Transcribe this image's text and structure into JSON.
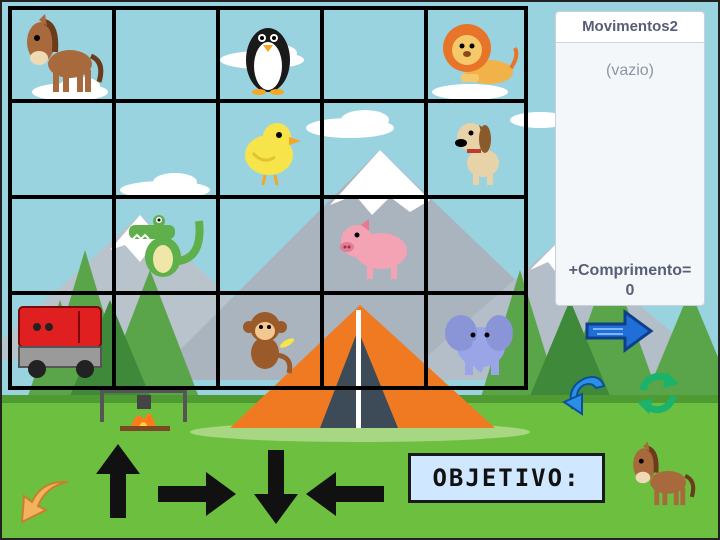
{
  "variable_monitor": {
    "title": "Movimentos2",
    "empty_text": "(vazio)",
    "length_label": "+Comprimento=",
    "length_value": "0"
  },
  "objective": {
    "label": "OBJETIVO:"
  },
  "grid": {
    "rows": 4,
    "cols": 5,
    "animals": [
      {
        "name": "horse",
        "row": 0,
        "col": 0
      },
      {
        "name": "penguin",
        "row": 0,
        "col": 2
      },
      {
        "name": "lion",
        "row": 0,
        "col": 4
      },
      {
        "name": "chick",
        "row": 1,
        "col": 2
      },
      {
        "name": "dog",
        "row": 1,
        "col": 4
      },
      {
        "name": "crocodile",
        "row": 2,
        "col": 1
      },
      {
        "name": "pig",
        "row": 2,
        "col": 3
      },
      {
        "name": "truck",
        "row": 3,
        "col": 0
      },
      {
        "name": "monkey",
        "row": 3,
        "col": 2
      },
      {
        "name": "elephant",
        "row": 3,
        "col": 4
      }
    ]
  },
  "objective_animal": "horse",
  "icons": {
    "up": "arrow-up-icon",
    "right": "arrow-right-icon",
    "down": "arrow-down-icon",
    "left": "arrow-left-icon",
    "run": "blue-arrow-right-icon",
    "undo": "undo-icon",
    "restart": "restart-icon",
    "back": "back-arrow-icon"
  },
  "colors": {
    "grid_lines": "#000000",
    "blue_button": "#1f6fd6",
    "green_button": "#1bb36b",
    "tent": "#f07a22",
    "objective_bg": "#cfe7ff"
  }
}
